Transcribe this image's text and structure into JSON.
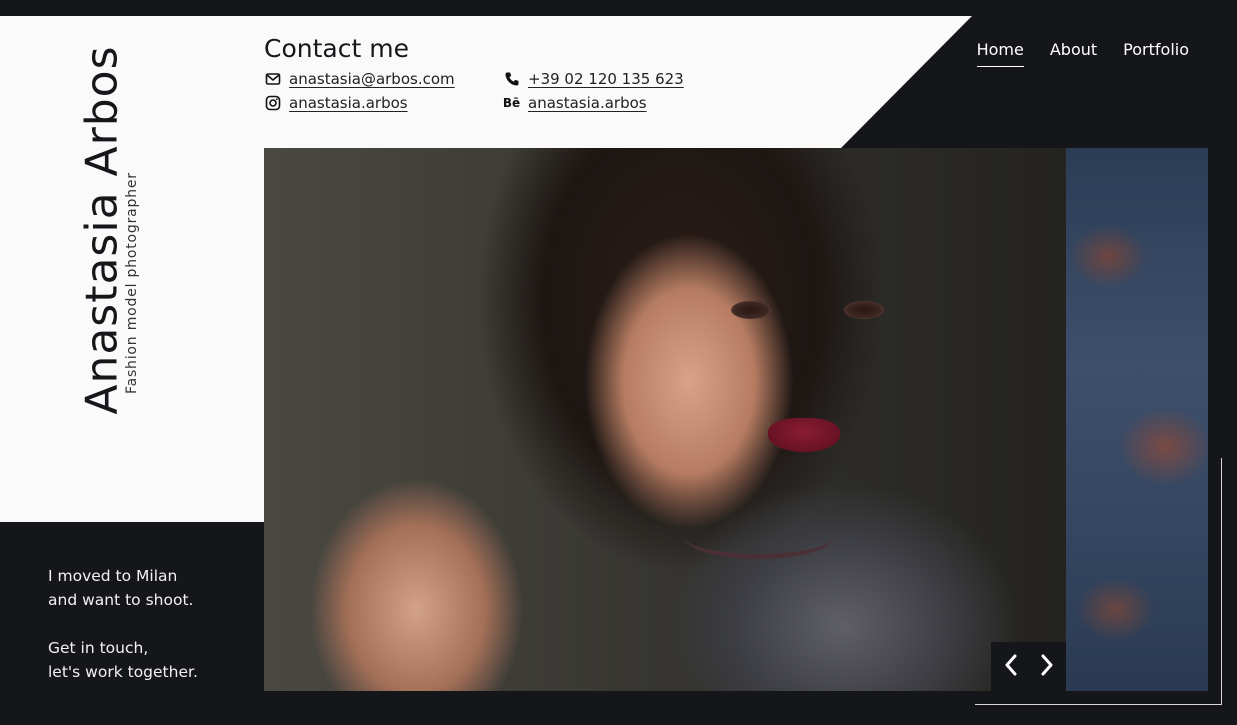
{
  "profile": {
    "name": "Anastasia Arbos",
    "subtitle": "Fashion model photographer"
  },
  "contact": {
    "title": "Contact me",
    "email": "anastasia@arbos.com",
    "phone": "+39 02 120 135 623",
    "instagram": "anastasia.arbos",
    "behance": "anastasia.arbos",
    "behance_glyph": "Bē"
  },
  "nav": {
    "items": [
      {
        "label": "Home",
        "active": true
      },
      {
        "label": "About",
        "active": false
      },
      {
        "label": "Portfolio",
        "active": false
      }
    ]
  },
  "about": {
    "line1": "I moved to Milan",
    "line2": "and want to shoot.",
    "line3": "Get in touch,",
    "line4": "let's work together."
  },
  "icons": {
    "email": "mail-icon",
    "phone": "phone-icon",
    "instagram": "instagram-icon",
    "behance": "behance-icon",
    "prev": "chevron-left-icon",
    "next": "chevron-right-icon"
  }
}
